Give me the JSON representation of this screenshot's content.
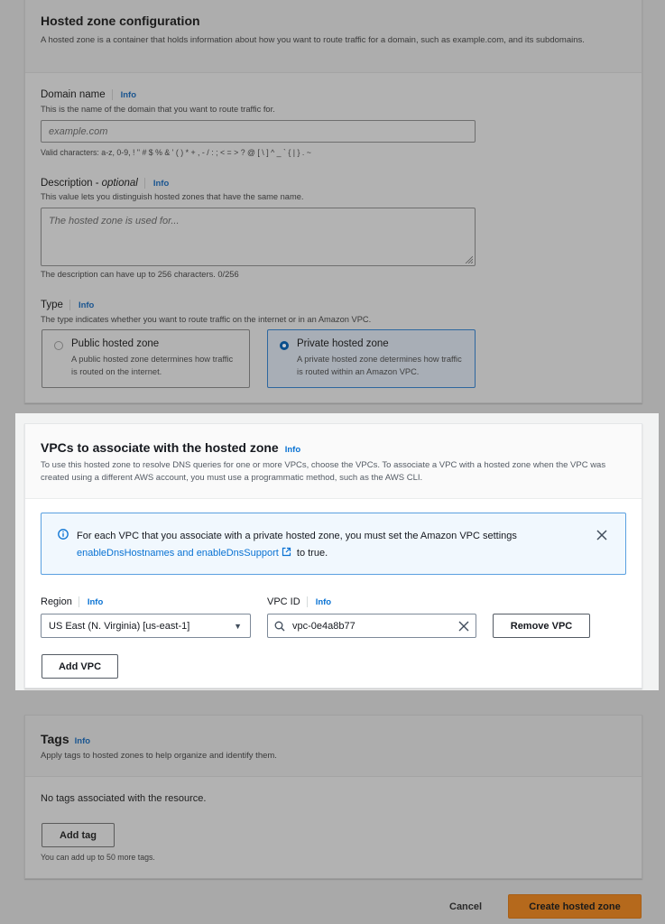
{
  "hosted_zone_config": {
    "title": "Hosted zone configuration",
    "description": "A hosted zone is a container that holds information about how you want to route traffic for a domain, such as example.com, and its subdomains.",
    "domain_name": {
      "label": "Domain name",
      "info": "Info",
      "hint": "This is the name of the domain that you want to route traffic for.",
      "value": "",
      "placeholder": "example.com",
      "constraint": "Valid characters: a-z, 0-9, ! \" # $ % & ' ( ) * + , - / : ; < = > ? @ [ \\ ] ^ _ ` { | } . ~"
    },
    "description_field": {
      "label": "Description - ",
      "label_optional": "optional",
      "info": "Info",
      "hint": "This value lets you distinguish hosted zones that have the same name.",
      "value": "",
      "placeholder": "The hosted zone is used for...",
      "counter": "The description can have up to 256 characters. 0/256"
    },
    "type": {
      "label": "Type",
      "info": "Info",
      "hint": "The type indicates whether you want to route traffic on the internet or in an Amazon VPC.",
      "options": [
        {
          "label": "Public hosted zone",
          "description": "A public hosted zone determines how traffic is routed on the internet.",
          "selected": false
        },
        {
          "label": "Private hosted zone",
          "description": "A private hosted zone determines how traffic is routed within an Amazon VPC.",
          "selected": true
        }
      ]
    }
  },
  "vpcs": {
    "title": "VPCs to associate with the hosted zone",
    "info": "Info",
    "description": "To use this hosted zone to resolve DNS queries for one or more VPCs, choose the VPCs. To associate a VPC with a hosted zone when the VPC was created using a different AWS account, you must use a programmatic method, such as the AWS CLI.",
    "alert": {
      "icon": "info-circle-icon",
      "text": "For each VPC that you associate with a private hosted zone, you must set the Amazon VPC settings ",
      "link_text": "enableDnsHostnames and enableDnsSupport",
      "link_icon": "external-link-icon",
      "suffix": " to true.",
      "close_icon": "close-icon"
    },
    "region": {
      "label": "Region",
      "info": "Info",
      "selected": "US East (N. Virginia) [us-east-1]"
    },
    "vpc_id": {
      "label": "VPC ID",
      "info": "Info",
      "value": "vpc-0e4a8b77"
    },
    "remove_button": "Remove VPC",
    "add_button": "Add VPC"
  },
  "tags": {
    "title": "Tags",
    "info": "Info",
    "description": "Apply tags to hosted zones to help organize and identify them.",
    "empty": "No tags associated with the resource.",
    "add_button": "Add tag",
    "limit": "You can add up to 50 more tags."
  },
  "footer": {
    "cancel": "Cancel",
    "create": "Create hosted zone"
  },
  "colors": {
    "primary_button": "#ec7211",
    "link": "#0972d3",
    "alert_background": "#f1f8fe"
  }
}
